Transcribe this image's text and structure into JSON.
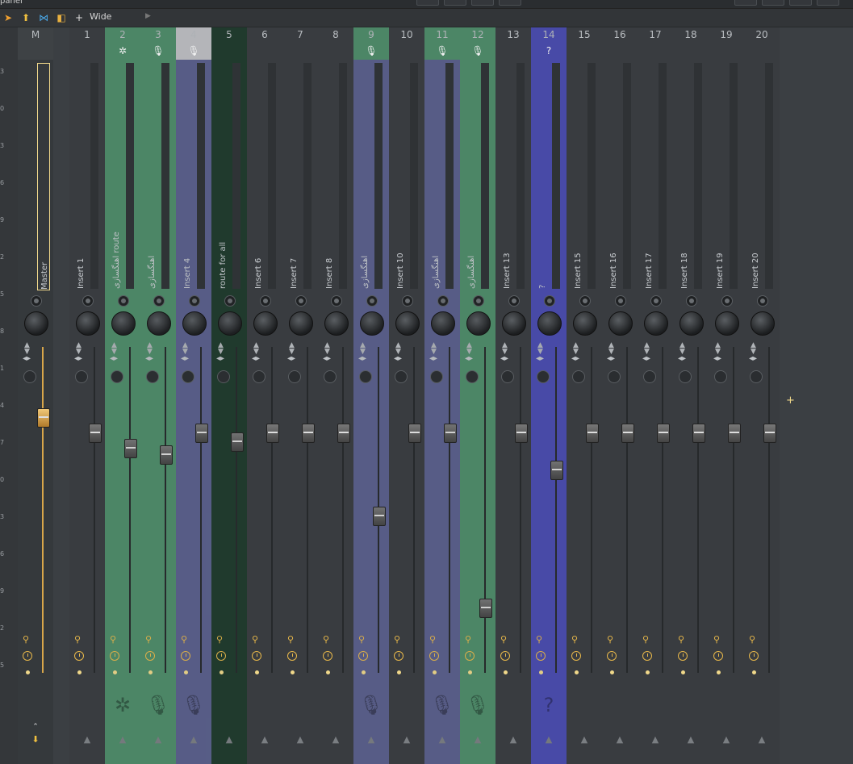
{
  "topbar": {
    "title": "panel"
  },
  "toolbar": {
    "preset_label": "Wide",
    "add_symbol": "+"
  },
  "ruler": {
    "ticks": [
      "3",
      "0",
      "3",
      "6",
      "9",
      "2",
      "5",
      "8",
      "1",
      "4",
      "7",
      "0",
      "3",
      "6",
      "9",
      "2",
      "5"
    ]
  },
  "master": {
    "num": "M",
    "label": "Master"
  },
  "colors": {
    "green": "#4e8d6a",
    "lavender": "#5a5f8c",
    "silver": "#bfc0c4",
    "dark_green": "#1e3a2c",
    "indigo": "#4a4bb0"
  },
  "strips": [
    {
      "num": "1",
      "label": "Insert 1",
      "bg": "",
      "hdr": ""
    },
    {
      "num": "2",
      "label": "اهنگسازی route",
      "bg": "green",
      "hdr": "green",
      "icon": "waveform-icon"
    },
    {
      "num": "3",
      "label": "اهنگسازی",
      "bg": "green",
      "hdr": "green",
      "icon": "microphone-icon"
    },
    {
      "num": "4",
      "label": "Insert 4",
      "bg": "lavender",
      "hdr": "silver",
      "icon": "microphone-icon"
    },
    {
      "num": "5",
      "label": "route for all",
      "bg": "dark_green",
      "hdr": "dark_green"
    },
    {
      "num": "6",
      "label": "Insert 6",
      "bg": "",
      "hdr": ""
    },
    {
      "num": "7",
      "label": "Insert 7",
      "bg": "",
      "hdr": ""
    },
    {
      "num": "8",
      "label": "Insert 8",
      "bg": "",
      "hdr": ""
    },
    {
      "num": "9",
      "label": "اهنگسازی",
      "bg": "lavender",
      "hdr": "green",
      "icon": "microphone-icon"
    },
    {
      "num": "10",
      "label": "Insert 10",
      "bg": "",
      "hdr": ""
    },
    {
      "num": "11",
      "label": "اهنگسازی",
      "bg": "lavender",
      "hdr": "green",
      "icon": "microphone-icon"
    },
    {
      "num": "12",
      "label": "اهنگسازی",
      "bg": "green",
      "hdr": "green",
      "icon": "microphone-icon"
    },
    {
      "num": "13",
      "label": "Insert 13",
      "bg": "",
      "hdr": ""
    },
    {
      "num": "14",
      "label": "?",
      "bg": "indigo",
      "hdr": "indigo",
      "icon": "question-icon",
      "icon_text": "?"
    },
    {
      "num": "15",
      "label": "Insert 15",
      "bg": "",
      "hdr": ""
    },
    {
      "num": "16",
      "label": "Insert 16",
      "bg": "",
      "hdr": ""
    },
    {
      "num": "17",
      "label": "Insert 17",
      "bg": "",
      "hdr": ""
    },
    {
      "num": "18",
      "label": "Insert 18",
      "bg": "",
      "hdr": ""
    },
    {
      "num": "19",
      "label": "Insert 19",
      "bg": "",
      "hdr": ""
    },
    {
      "num": "20",
      "label": "Insert 20",
      "bg": "",
      "hdr": ""
    }
  ],
  "fader_levels": [
    0.75,
    0.7,
    0.68,
    0.75,
    0.72,
    0.75,
    0.75,
    0.75,
    0.48,
    0.75,
    0.75,
    0.18,
    0.75,
    0.63,
    0.75,
    0.75,
    0.75,
    0.75,
    0.75,
    0.75
  ],
  "master_level": 0.8
}
